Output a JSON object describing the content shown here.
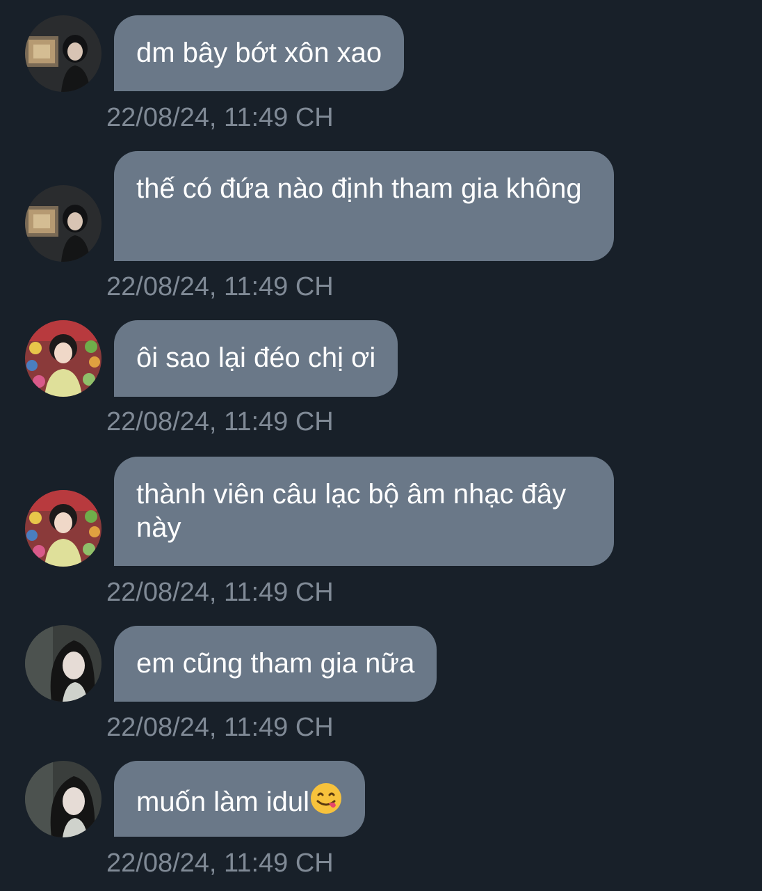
{
  "messages": [
    {
      "avatar": "avatar-dark-room",
      "text": "dm bây bớt xôn xao",
      "time": "22/08/24, 11:49 CH"
    },
    {
      "avatar": "avatar-dark-room",
      "text": "thế có đứa nào định tham gia không",
      "time": "22/08/24, 11:49 CH"
    },
    {
      "avatar": "avatar-colorful-shelf",
      "text": "ôi sao lại đéo chị ơi",
      "time": "22/08/24, 11:49 CH"
    },
    {
      "avatar": "avatar-colorful-shelf",
      "text": "thành viên câu lạc bộ âm nhạc đây này",
      "time": "22/08/24, 11:49 CH"
    },
    {
      "avatar": "avatar-long-hair",
      "text": "em cũng tham gia nữa",
      "time": "22/08/24, 11:49 CH"
    },
    {
      "avatar": "avatar-long-hair",
      "text": "muốn làm idul",
      "emoji": "face-savoring-food-emoji",
      "time": "22/08/24, 11:49 CH"
    }
  ],
  "colors": {
    "background": "#182029",
    "bubble": "#6a7888",
    "timestamp": "#808a96",
    "text": "#ffffff"
  }
}
